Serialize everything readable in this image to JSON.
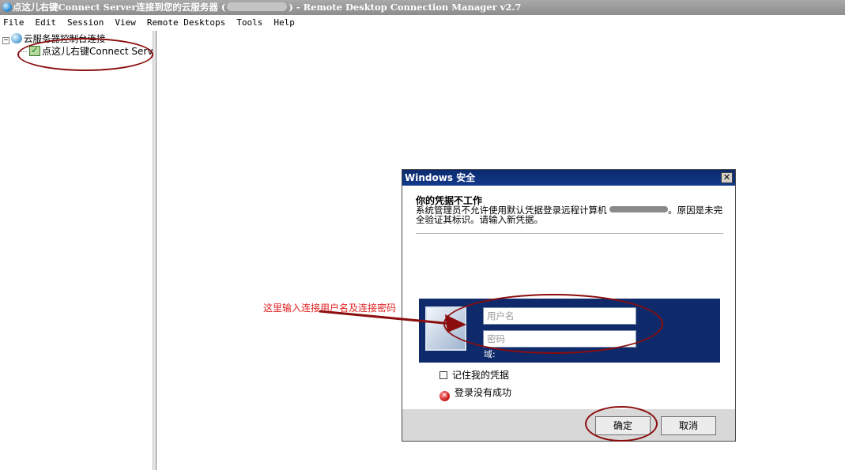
{
  "window": {
    "title_prefix": "点这儿右键Connect Server连接到您的云服务器 (",
    "title_suffix": ") - Remote Desktop Connection Manager v2.7"
  },
  "menu": [
    "File",
    "Edit",
    "Session",
    "View",
    "Remote Desktops",
    "Tools",
    "Help"
  ],
  "tree": {
    "expander": "−",
    "group_label": "云服务器控制台连接",
    "server_label": "点这儿右键Connect Serv"
  },
  "dialog": {
    "title": "Windows 安全",
    "close": "✕",
    "heading": "你的凭据不工作",
    "message_before": "系统管理员不允许使用默认凭据登录远程计算机",
    "message_after": "。原因是未完全验证其标识。请输入新凭据。",
    "username_placeholder": "用户名",
    "password_placeholder": "密码",
    "domain_label": "域:",
    "remember_label": "记住我的凭据",
    "error_text": "登录没有成功",
    "ok_button": "确定",
    "cancel_button": "取消"
  },
  "annotation": {
    "label": "这里输入连接用户名及连接密码",
    "color": "#e02020",
    "ellipse_color": "#8b0d0d"
  },
  "colors": {
    "titlebar": "#9a9a9a",
    "dialog_titlebar": "#0b2a6e",
    "credential_panel": "#0f2a6b"
  }
}
